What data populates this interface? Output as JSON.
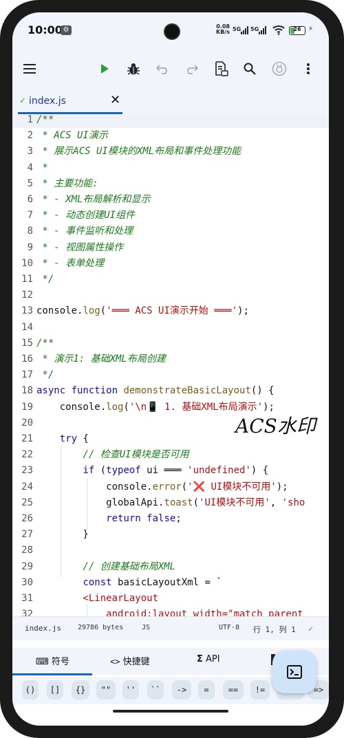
{
  "status_bar": {
    "time": "10:00",
    "net_speed_value": "0.08",
    "net_speed_unit": "KB/s",
    "sim1": "5G",
    "sim2": "5G",
    "battery": "26"
  },
  "toolbar": {
    "icons": [
      "menu-icon",
      "run-icon",
      "debug-icon",
      "undo-icon",
      "redo-icon",
      "file-info-icon",
      "search-icon",
      "plugin-icon",
      "more-icon"
    ]
  },
  "tab": {
    "filename": "index.js",
    "saved_mark": "✓",
    "close": "✕"
  },
  "editor": {
    "line_numbers": [
      "1",
      "2",
      "3",
      "4",
      "5",
      "6",
      "7",
      "8",
      "9",
      "10",
      "11",
      "12",
      "13",
      "14",
      "15",
      "16",
      "17",
      "18",
      "19",
      "20",
      "21",
      "22",
      "23",
      "24",
      "25",
      "26",
      "27",
      "28",
      "29",
      "30",
      "31",
      "32"
    ],
    "lines": [
      [
        {
          "t": "/**",
          "c": "cmt"
        }
      ],
      [
        {
          "t": " * ACS UI演示",
          "c": "cmt"
        }
      ],
      [
        {
          "t": " * 展示ACS UI模块的XML布局和事件处理功能",
          "c": "cmt"
        }
      ],
      [
        {
          "t": " *",
          "c": "cmt"
        }
      ],
      [
        {
          "t": " * 主要功能:",
          "c": "cmt"
        }
      ],
      [
        {
          "t": " * - XML布局解析和显示",
          "c": "cmt"
        }
      ],
      [
        {
          "t": " * - 动态创建UI组件",
          "c": "cmt"
        }
      ],
      [
        {
          "t": " * - 事件监听和处理",
          "c": "cmt"
        }
      ],
      [
        {
          "t": " * - 视图属性操作",
          "c": "cmt"
        }
      ],
      [
        {
          "t": " * - 表单处理",
          "c": "cmt"
        }
      ],
      [
        {
          "t": " */",
          "c": "cmt"
        }
      ],
      [],
      [
        {
          "t": "console.",
          "c": ""
        },
        {
          "t": "log",
          "c": "fn"
        },
        {
          "t": "(",
          "c": ""
        },
        {
          "t": "'═══ ACS UI演示开始 ═══'",
          "c": "str"
        },
        {
          "t": ");",
          "c": ""
        }
      ],
      [],
      [
        {
          "t": "/**",
          "c": "cmt"
        }
      ],
      [
        {
          "t": " * 演示1: 基础XML布局创建",
          "c": "cmt"
        }
      ],
      [
        {
          "t": " */",
          "c": "cmt"
        }
      ],
      [
        {
          "t": "async function ",
          "c": "kw"
        },
        {
          "t": "demonstrateBasicLayout",
          "c": "fn"
        },
        {
          "t": "() {",
          "c": ""
        }
      ],
      [
        {
          "t": "    console.",
          "c": ""
        },
        {
          "t": "log",
          "c": "fn"
        },
        {
          "t": "(",
          "c": ""
        },
        {
          "t": "'\\n📱 1. 基础XML布局演示'",
          "c": "str"
        },
        {
          "t": ");",
          "c": ""
        }
      ],
      [],
      [
        {
          "t": "    ",
          "c": ""
        },
        {
          "t": "try",
          "c": "kw"
        },
        {
          "t": " {",
          "c": ""
        }
      ],
      [
        {
          "t": "        // 检查UI模块是否可用",
          "c": "cmt"
        }
      ],
      [
        {
          "t": "        ",
          "c": ""
        },
        {
          "t": "if",
          "c": "kw"
        },
        {
          "t": " (",
          "c": ""
        },
        {
          "t": "typeof",
          "c": "kw"
        },
        {
          "t": " ui ═══ ",
          "c": ""
        },
        {
          "t": "'undefined'",
          "c": "str"
        },
        {
          "t": ") {",
          "c": ""
        }
      ],
      [
        {
          "t": "            console.",
          "c": ""
        },
        {
          "t": "error",
          "c": "fn"
        },
        {
          "t": "(",
          "c": ""
        },
        {
          "t": "'❌ UI模块不可用'",
          "c": "str"
        },
        {
          "t": ");",
          "c": ""
        }
      ],
      [
        {
          "t": "            globalApi.",
          "c": ""
        },
        {
          "t": "toast",
          "c": "fn"
        },
        {
          "t": "(",
          "c": ""
        },
        {
          "t": "'UI模块不可用'",
          "c": "str"
        },
        {
          "t": ", ",
          "c": ""
        },
        {
          "t": "'sho",
          "c": "str"
        }
      ],
      [
        {
          "t": "            ",
          "c": ""
        },
        {
          "t": "return false",
          "c": "kw"
        },
        {
          "t": ";",
          "c": ""
        }
      ],
      [
        {
          "t": "        }",
          "c": ""
        }
      ],
      [],
      [
        {
          "t": "        // 创建基础布局XML",
          "c": "cmt"
        }
      ],
      [
        {
          "t": "        ",
          "c": ""
        },
        {
          "t": "const",
          "c": "kw"
        },
        {
          "t": " basicLayoutXml = `",
          "c": ""
        }
      ],
      [
        {
          "t": "        <LinearLayout",
          "c": "str"
        }
      ],
      [
        {
          "t": "            android:layout_width=\"match_parent",
          "c": "str"
        }
      ]
    ]
  },
  "watermark": "ACS水印",
  "info_bar": {
    "filename": "index.js",
    "size": "29786 bytes",
    "language": "JS",
    "encoding": "UTF-8",
    "position": "行 1, 列 1",
    "check": "✓"
  },
  "bottom_tabs": [
    {
      "icon": "⌨",
      "label": "符号"
    },
    {
      "icon": "<>",
      "label": "快捷键"
    },
    {
      "icon": "Σ",
      "label": "API"
    }
  ],
  "symbols": [
    "()",
    "[]",
    "{}",
    "\"\"",
    "''",
    "``",
    "->",
    "=",
    "==",
    "!=",
    "",
    "=>"
  ]
}
